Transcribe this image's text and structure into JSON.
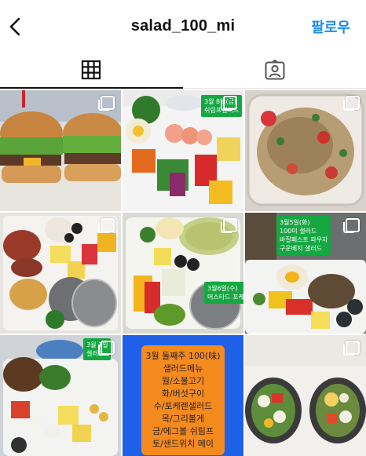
{
  "header": {
    "username": "salad_100_mi",
    "follow_label": "팔로우"
  },
  "tabs": [
    {
      "name": "grid",
      "icon": "grid-icon"
    },
    {
      "name": "tagged",
      "icon": "person-tag-icon"
    }
  ],
  "posts": {
    "p2_tag": [
      "3월 8일(금)",
      "쉬림프샐러드"
    ],
    "p6_tag": [
      "3월5일(화)",
      "100미 샐러드",
      "바질페스토 파우차",
      "구운베지 샐러드"
    ],
    "p5_tag": [
      "3월6일(수)",
      "머스타드 포케"
    ],
    "p7_tag": [
      "3월 1일",
      "샐러드"
    ],
    "menu_card": [
      "3월 둘째주 100(味)",
      "샐러드메뉴",
      "월/소불고기",
      "화/버섯구이",
      "수/포케렌샐러드",
      "목/그리볼게",
      "금/에그볼 쉬림프",
      "토/샌드위치 메이"
    ]
  },
  "colors": {
    "accent": "#1a8cf0",
    "tag_green": "#15a842",
    "card_orange": "#f58a1f",
    "card_bg_blue": "#1e60e8"
  }
}
